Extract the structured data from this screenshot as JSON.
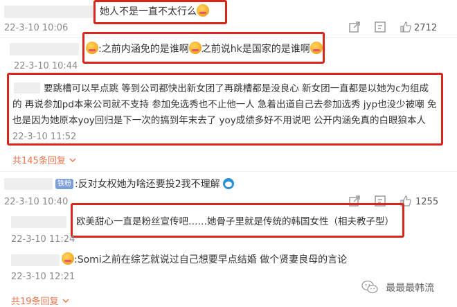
{
  "comments": [
    {
      "text": "她人不是一直不太行么",
      "time": "22-3-10 10:06",
      "likes": "2712"
    },
    {
      "text": ":之前内涵免的是谁啊",
      "text2": "之前说hk是国家的是谁啊",
      "time": "22-3-10 10:44"
    },
    {
      "lines": [
        "要跳槽可以早点跳 等到公司都快出新女团了再跳槽都是没良心  新女团一直都是以她为c为组成",
        "的 再说参加pd本来公司就不支持 参加免选秀也不止他一人 急着出道自己去参加选秀 jyp也没少被嘲 免",
        "也是因为她原本yoy回归是下一次的搞到年末去了 yoy成绩多好不用说吧 公开内涵免真的白眼狼本人"
      ],
      "time": "22-3-10 11:52"
    },
    {
      "text": ":反对女权她为啥还要投2我不理解",
      "badge": "铁粉",
      "time": "22-3-10 10:40",
      "likes": "1255"
    },
    {
      "text": "欧美甜心一直是粉丝宣传吧……她骨子里就是传统的韩国女性（相夫教子型）",
      "time": "22-3-10 11:24"
    },
    {
      "text": ":Somi之前在综艺就说过自己想要早点结婚 做个贤妻良母的言论",
      "time": "22-3-10 12:21"
    }
  ],
  "reply_links": [
    "共145条回复",
    "共19条回复"
  ],
  "watermark": "最最最韩流",
  "colors": {
    "highlight": "#d9261c",
    "link": "#eb7350",
    "time": "#8a8a8a"
  },
  "icons": [
    "share-icon",
    "comment-icon",
    "like-icon",
    "chevron-down-icon",
    "wechat-logo-icon"
  ]
}
